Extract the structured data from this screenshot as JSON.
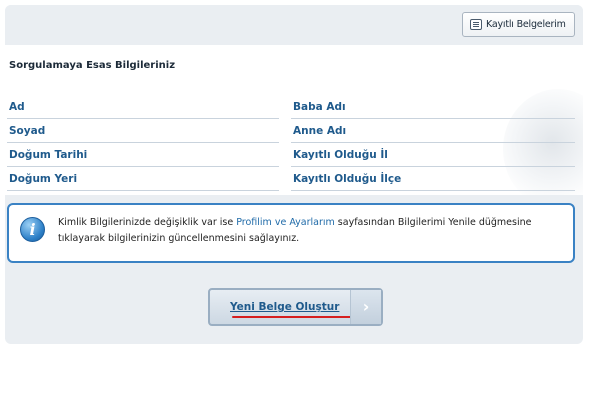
{
  "toolbar": {
    "saved_docs_label": "Kayıtlı Belgelerim",
    "saved_docs_icon": "document-list-icon"
  },
  "section": {
    "title": "Sorgulamaya Esas Bilgileriniz"
  },
  "fields": {
    "name": "Ad",
    "father_name": "Baba Adı",
    "surname": "Soyad",
    "mother_name": "Anne Adı",
    "birth_date": "Doğum Tarihi",
    "registered_province": "Kayıtlı Olduğu İl",
    "birth_place": "Doğum Yeri",
    "registered_district": "Kayıtlı Olduğu İlçe"
  },
  "info": {
    "icon": "info-icon",
    "text_before": "Kimlik Bilgilerinizde değişiklik var ise ",
    "link": "Profilim ve Ayarlarım",
    "text_after": " sayfasından Bilgilerimi Yenile düğmesine tıklayarak bilgilerinizin güncellenmesini sağlayınız."
  },
  "actions": {
    "create_label": "Yeni Belge Oluştur",
    "arrow_glyph": "›"
  },
  "colors": {
    "link_blue": "#1f5a8c",
    "info_border": "#3a82c4",
    "highlight_red": "#d61f1f",
    "panel_bg": "#eaeef2"
  }
}
